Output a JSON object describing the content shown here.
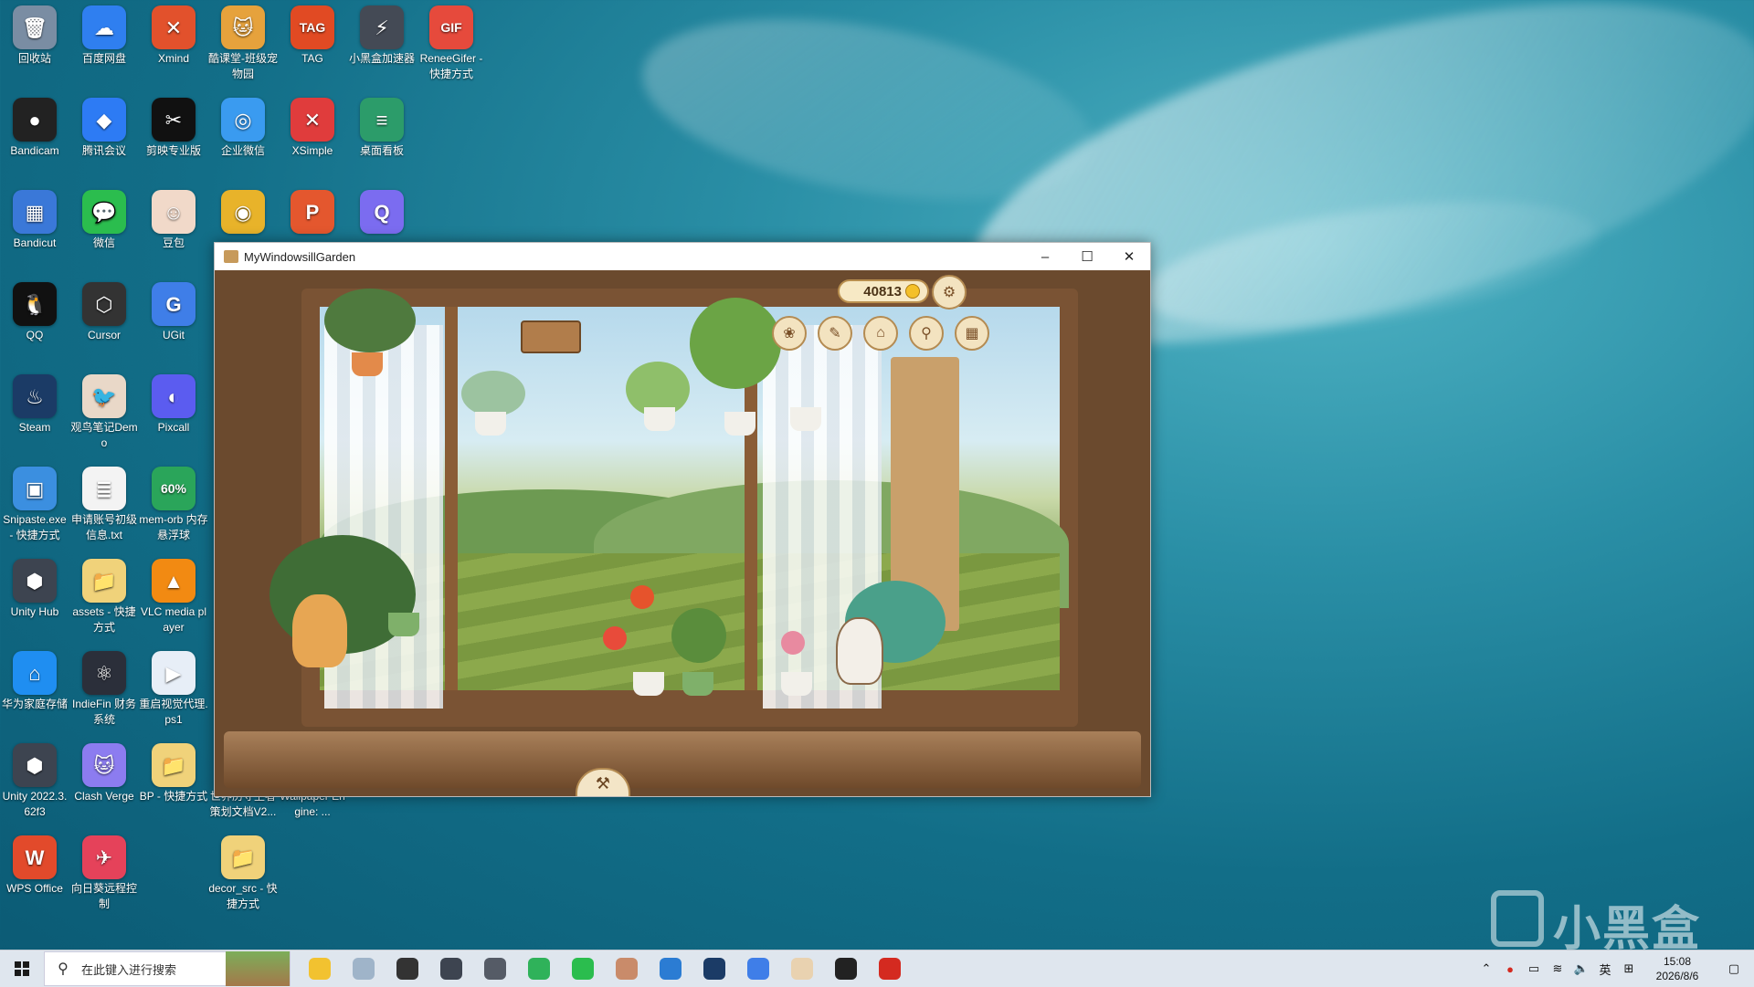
{
  "desktop": {
    "icons": [
      {
        "label": "回收站",
        "color": "#7a8da3",
        "glyph": "🗑",
        "col": 0,
        "row": 0
      },
      {
        "label": "百度网盘",
        "color": "#2f7ff0",
        "glyph": "☁",
        "col": 1,
        "row": 0
      },
      {
        "label": "Xmind",
        "color": "#e2512c",
        "glyph": "✕",
        "col": 2,
        "row": 0
      },
      {
        "label": "酷课堂-班级宠物园",
        "color": "#e6a23c",
        "glyph": "🐱",
        "col": 3,
        "row": 0
      },
      {
        "label": "TAG",
        "color": "#e14a23",
        "glyph": "TAG",
        "col": 4,
        "row": 0
      },
      {
        "label": "小黑盒加速器",
        "color": "#444a55",
        "glyph": "⚡",
        "col": 5,
        "row": 0
      },
      {
        "label": "ReneeGifer - 快捷方式",
        "color": "#e64a3c",
        "glyph": "GIF",
        "col": 6,
        "row": 0
      },
      {
        "label": "Bandicam",
        "color": "#222222",
        "glyph": "●",
        "col": 0,
        "row": 1
      },
      {
        "label": "腾讯会议",
        "color": "#2d7bf4",
        "glyph": "◆",
        "col": 1,
        "row": 1
      },
      {
        "label": "剪映专业版",
        "color": "#111111",
        "glyph": "✂",
        "col": 2,
        "row": 1
      },
      {
        "label": "企业微信",
        "color": "#3a9bf0",
        "glyph": "◎",
        "col": 3,
        "row": 1
      },
      {
        "label": "XSimple",
        "color": "#e03c3c",
        "glyph": "✕",
        "col": 4,
        "row": 1
      },
      {
        "label": "桌面看板",
        "color": "#2c9c6a",
        "glyph": "≡",
        "col": 5,
        "row": 1
      },
      {
        "label": "Bandicut",
        "color": "#3a78d8",
        "glyph": "▦",
        "col": 0,
        "row": 2
      },
      {
        "label": "微信",
        "color": "#2bbd4e",
        "glyph": "💬",
        "col": 1,
        "row": 2
      },
      {
        "label": "豆包",
        "color": "#f1d9c9",
        "glyph": "☺",
        "col": 2,
        "row": 2
      },
      {
        "label": "",
        "color": "#e8b32a",
        "glyph": "◉",
        "col": 3,
        "row": 2
      },
      {
        "label": "",
        "color": "#e4572e",
        "glyph": "P",
        "col": 4,
        "row": 2
      },
      {
        "label": "",
        "color": "#7b6cf0",
        "glyph": "Q",
        "col": 5,
        "row": 2
      },
      {
        "label": "QQ",
        "color": "#111111",
        "glyph": "🐧",
        "col": 0,
        "row": 3
      },
      {
        "label": "Cursor",
        "color": "#333333",
        "glyph": "⬡",
        "col": 1,
        "row": 3
      },
      {
        "label": "UGit",
        "color": "#3f7ee8",
        "glyph": "G",
        "col": 2,
        "row": 3
      },
      {
        "label": "Steam",
        "color": "#1b3b66",
        "glyph": "♨",
        "col": 0,
        "row": 4
      },
      {
        "label": "观鸟笔记Demo",
        "color": "#e9d8c8",
        "glyph": "🐦",
        "col": 1,
        "row": 4
      },
      {
        "label": "Pixcall",
        "color": "#5b5cf0",
        "glyph": "◐",
        "col": 2,
        "row": 4
      },
      {
        "label": "Snipaste.exe - 快捷方式",
        "color": "#3b8fe0",
        "glyph": "▣",
        "col": 0,
        "row": 5
      },
      {
        "label": "申请账号初级信息.txt",
        "color": "#f3f3f3",
        "glyph": "≣",
        "col": 1,
        "row": 5
      },
      {
        "label": "mem-orb 内存悬浮球",
        "color": "#2aa55a",
        "glyph": "60%",
        "col": 2,
        "row": 5
      },
      {
        "label": "Unity Hub",
        "color": "#3d4450",
        "glyph": "⬢",
        "col": 0,
        "row": 6
      },
      {
        "label": "assets - 快捷方式",
        "color": "#f0d27a",
        "glyph": "📁",
        "col": 1,
        "row": 6
      },
      {
        "label": "VLC media player",
        "color": "#f28a12",
        "glyph": "▲",
        "col": 2,
        "row": 6
      },
      {
        "label": "华为家庭存储",
        "color": "#1f8ef1",
        "glyph": "⌂",
        "col": 0,
        "row": 7
      },
      {
        "label": "IndieFin 财务系统",
        "color": "#2b2f3a",
        "glyph": "⚛",
        "col": 1,
        "row": 7
      },
      {
        "label": "重启视觉代理.ps1",
        "color": "#e7eef7",
        "glyph": "▶",
        "col": 2,
        "row": 7
      },
      {
        "label": "Unity 2022.3.62f3",
        "color": "#3d4450",
        "glyph": "⬢",
        "col": 0,
        "row": 8
      },
      {
        "label": "Clash Verge",
        "color": "#8c7cf0",
        "glyph": "🐱",
        "col": 1,
        "row": 8
      },
      {
        "label": "BP - 快捷方式",
        "color": "#f0d27a",
        "glyph": "📁",
        "col": 2,
        "row": 8
      },
      {
        "label": "世界历守卫者策划文档V2...",
        "color": "#f0d27a",
        "glyph": "📄",
        "col": 3,
        "row": 8
      },
      {
        "label": "Wallpaper Engine: ...",
        "color": "#2e6fbf",
        "glyph": "▤",
        "col": 4,
        "row": 8
      },
      {
        "label": "WPS Office",
        "color": "#e24a2b",
        "glyph": "W",
        "col": 0,
        "row": 9
      },
      {
        "label": "向日葵远程控制",
        "color": "#e5425a",
        "glyph": "✈",
        "col": 1,
        "row": 9
      },
      {
        "label": "decor_src - 快捷方式",
        "color": "#f0d27a",
        "glyph": "📁",
        "col": 3,
        "row": 9
      }
    ]
  },
  "window": {
    "title": "MyWindowsillGarden",
    "minimize": "–",
    "maximize": "☐",
    "close": "✕"
  },
  "game": {
    "coins": "40813",
    "settings_icon": "gear-icon",
    "tool_buttons": [
      {
        "name": "seed-icon",
        "glyph": "❀"
      },
      {
        "name": "pencil-icon",
        "glyph": "✎"
      },
      {
        "name": "shop-icon",
        "glyph": "⌂"
      },
      {
        "name": "magnifier-icon",
        "glyph": "⚲"
      },
      {
        "name": "album-icon",
        "glyph": "▦"
      }
    ],
    "bottom_tab": "hammer-wrench-icon"
  },
  "taskbar": {
    "search_placeholder": "在此键入进行搜索",
    "apps": [
      {
        "name": "file-explorer",
        "color": "#f2c230"
      },
      {
        "name": "photos",
        "color": "#9fb4c9"
      },
      {
        "name": "chatgpt",
        "color": "#333333"
      },
      {
        "name": "unity",
        "color": "#3d4450"
      },
      {
        "name": "unity-hub",
        "color": "#555b66"
      },
      {
        "name": "messages",
        "color": "#2fb25a"
      },
      {
        "name": "wechat",
        "color": "#2bbd4e"
      },
      {
        "name": "doubao",
        "color": "#c98b6a"
      },
      {
        "name": "bandicam-b",
        "color": "#2b7cd3"
      },
      {
        "name": "steam",
        "color": "#1b3b66"
      },
      {
        "name": "ugit",
        "color": "#3f7ee8"
      },
      {
        "name": "garden-cat",
        "color": "#e9d2b0"
      },
      {
        "name": "qq",
        "color": "#222222"
      },
      {
        "name": "bandicam-rec",
        "color": "#d42a20"
      }
    ],
    "ime": "英",
    "time": "15:08",
    "date": "2026/8/6"
  },
  "watermark": "小黑盒",
  "colors": {
    "accent": "#2f7ff0",
    "wood": "#7a5334"
  }
}
